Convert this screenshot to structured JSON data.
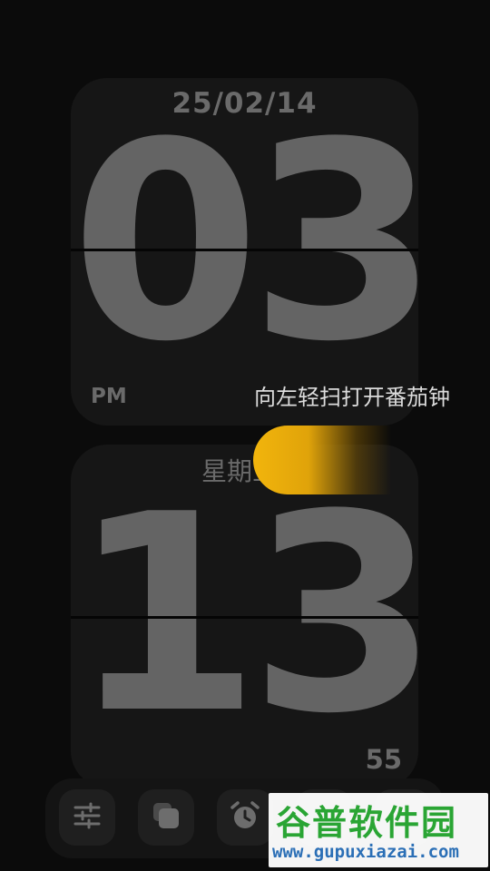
{
  "clock": {
    "date": "25/02/14",
    "hour": "03",
    "period": "PM",
    "weekday": "星期五",
    "minute": "13",
    "second": "55"
  },
  "swipe": {
    "hint": "向左轻扫打开番茄钟",
    "handle_color": "#f2b50c"
  },
  "toolbar": {
    "buttons": [
      {
        "icon": "sliders-icon"
      },
      {
        "icon": "theme-icon"
      },
      {
        "icon": "alarm-clock-icon"
      },
      {
        "icon": "unknown-icon"
      },
      {
        "icon": "unknown-icon"
      }
    ]
  },
  "watermark": {
    "logo": "谷普软件园",
    "url": "www.gupuxiazai.com"
  }
}
